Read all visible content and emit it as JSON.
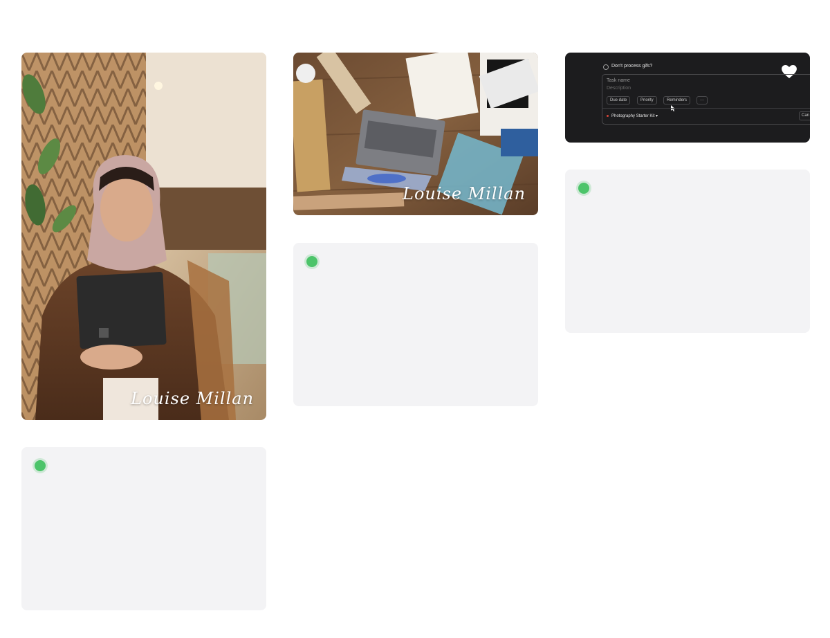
{
  "gallery": {
    "portrait_card": {
      "watermark": "Louise Millan"
    },
    "desk_card": {
      "watermark": "Louise Millan"
    },
    "task_screenshot_card": {
      "task_title": "Don't process gifs?",
      "task_name_placeholder": "Task name",
      "description_placeholder": "Description",
      "chips": [
        "Due date",
        "Priority",
        "Reminders",
        "···"
      ],
      "project": "Photography Starter Kit",
      "cancel_label": "Can"
    },
    "placeholder_cards": [
      {
        "status": "green"
      },
      {
        "status": "green"
      },
      {
        "status": "green"
      }
    ]
  },
  "colors": {
    "background": "#ffffff",
    "placeholder": "#f3f3f5",
    "status_dot": "#4cc46a",
    "screenshot_bg": "#1c1c1e"
  }
}
